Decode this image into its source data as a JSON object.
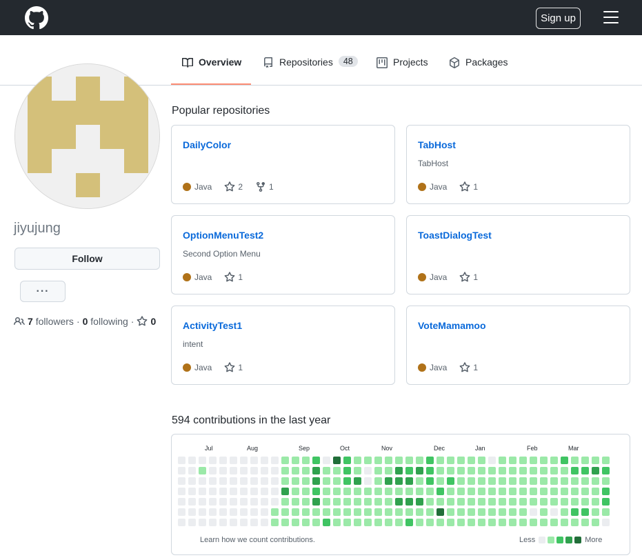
{
  "header": {
    "logo": "github-mark-icon",
    "signup_label": "Sign up",
    "menu_icon": "hamburger-menu-icon"
  },
  "tabs": [
    {
      "label": "Overview",
      "icon": "book-icon",
      "selected": true
    },
    {
      "label": "Repositories",
      "icon": "repo-icon",
      "count": "48"
    },
    {
      "label": "Projects",
      "icon": "project-icon"
    },
    {
      "label": "Packages",
      "icon": "package-icon"
    }
  ],
  "profile": {
    "username": "jiyujung",
    "follow_label": "Follow",
    "more_label": "···",
    "followers_count": "7",
    "followers_label": "followers",
    "separator": "·",
    "following_count": "0",
    "following_label": "following",
    "stars_count": "0",
    "avatar_color": "#d4c07a"
  },
  "popular": {
    "title": "Popular repositories",
    "repos": [
      {
        "name": "DailyColor",
        "description": "",
        "language": "Java",
        "stars": "2",
        "forks": "1"
      },
      {
        "name": "TabHost",
        "description": "TabHost",
        "language": "Java",
        "stars": "1"
      },
      {
        "name": "OptionMenuTest2",
        "description": "Second Option Menu",
        "language": "Java",
        "stars": "1"
      },
      {
        "name": "ToastDialogTest",
        "description": "",
        "language": "Java",
        "stars": "1"
      },
      {
        "name": "ActivityTest1",
        "description": "intent",
        "language": "Java",
        "stars": "1"
      },
      {
        "name": "VoteMamamoo",
        "description": "",
        "language": "Java",
        "stars": "1"
      }
    ],
    "language_color": "#b07219"
  },
  "contributions": {
    "title": "594 contributions in the last year",
    "months": [
      "Jul",
      "Aug",
      "Sep",
      "Oct",
      "Nov",
      "Dec",
      "Jan",
      "Feb",
      "Mar"
    ],
    "learn_text": "Learn how we count contributions.",
    "legend_less": "Less",
    "legend_more": "More",
    "level_colors": [
      "#ebedf0",
      "#9be9a8",
      "#40c463",
      "#30a14e",
      "#216e39"
    ],
    "weeks": [
      [
        0,
        0,
        0,
        0,
        0,
        0,
        0
      ],
      [
        0,
        0,
        0,
        0,
        0,
        0,
        0
      ],
      [
        0,
        1,
        0,
        0,
        0,
        0,
        0
      ],
      [
        0,
        0,
        0,
        0,
        0,
        0,
        0
      ],
      [
        0,
        0,
        0,
        0,
        0,
        0,
        0
      ],
      [
        0,
        0,
        0,
        0,
        0,
        0,
        0
      ],
      [
        0,
        0,
        0,
        0,
        0,
        0,
        0
      ],
      [
        0,
        0,
        0,
        0,
        0,
        0,
        0
      ],
      [
        0,
        0,
        0,
        0,
        0,
        0,
        0
      ],
      [
        0,
        0,
        0,
        0,
        0,
        1,
        1
      ],
      [
        1,
        1,
        1,
        3,
        1,
        1,
        1
      ],
      [
        1,
        1,
        1,
        1,
        1,
        1,
        1
      ],
      [
        1,
        1,
        1,
        1,
        1,
        1,
        1
      ],
      [
        2,
        3,
        3,
        2,
        3,
        1,
        1
      ],
      [
        0,
        1,
        1,
        1,
        1,
        1,
        2
      ],
      [
        4,
        1,
        1,
        1,
        1,
        1,
        1
      ],
      [
        2,
        2,
        2,
        1,
        1,
        1,
        1
      ],
      [
        1,
        1,
        3,
        1,
        1,
        1,
        1
      ],
      [
        1,
        0,
        0,
        1,
        1,
        1,
        1
      ],
      [
        1,
        1,
        1,
        1,
        1,
        1,
        1
      ],
      [
        1,
        1,
        3,
        1,
        1,
        1,
        1
      ],
      [
        1,
        3,
        3,
        1,
        3,
        1,
        1
      ],
      [
        1,
        2,
        3,
        1,
        3,
        1,
        2
      ],
      [
        1,
        3,
        1,
        1,
        3,
        1,
        1
      ],
      [
        2,
        2,
        2,
        1,
        1,
        1,
        1
      ],
      [
        1,
        1,
        1,
        2,
        1,
        4,
        1
      ],
      [
        1,
        1,
        2,
        1,
        1,
        1,
        1
      ],
      [
        1,
        1,
        1,
        1,
        1,
        1,
        1
      ],
      [
        1,
        1,
        1,
        1,
        1,
        1,
        1
      ],
      [
        1,
        1,
        1,
        1,
        1,
        1,
        1
      ],
      [
        0,
        1,
        1,
        1,
        1,
        1,
        1
      ],
      [
        1,
        1,
        1,
        1,
        1,
        1,
        1
      ],
      [
        1,
        1,
        1,
        1,
        1,
        1,
        1
      ],
      [
        1,
        1,
        1,
        1,
        1,
        1,
        1
      ],
      [
        1,
        1,
        1,
        1,
        1,
        0,
        1
      ],
      [
        1,
        1,
        1,
        1,
        1,
        1,
        1
      ],
      [
        1,
        1,
        1,
        1,
        1,
        0,
        1
      ],
      [
        2,
        1,
        1,
        1,
        1,
        1,
        1
      ],
      [
        1,
        2,
        1,
        1,
        1,
        2,
        1
      ],
      [
        1,
        2,
        1,
        1,
        1,
        2,
        1
      ],
      [
        1,
        3,
        1,
        1,
        1,
        1,
        1
      ],
      [
        1,
        2,
        1,
        2,
        2,
        1,
        0
      ]
    ]
  }
}
